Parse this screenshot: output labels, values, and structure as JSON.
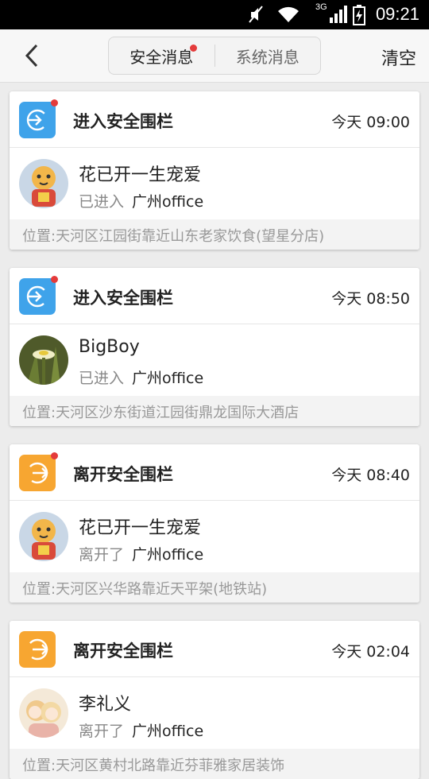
{
  "status_bar": {
    "network": "3G",
    "time": "09:21"
  },
  "header": {
    "tabs": [
      {
        "label": "安全消息",
        "active": true,
        "has_dot": true
      },
      {
        "label": "系统消息",
        "active": false,
        "has_dot": false
      }
    ],
    "clear_label": "清空"
  },
  "messages": [
    {
      "type": "enter",
      "title": "进入安全围栏",
      "time": "今天 09:00",
      "user": "花已开一生宠爱",
      "action": "已进入",
      "fence": "广州office",
      "location": "位置:天河区江园街靠近山东老家饮食(望星分店)",
      "unread": true,
      "avatar": "tiger-avatar"
    },
    {
      "type": "enter",
      "title": "进入安全围栏",
      "time": "今天 08:50",
      "user": "BigBoy",
      "action": "已进入",
      "fence": "广州office",
      "location": "位置:天河区沙东街道江园街鼎龙国际大酒店",
      "unread": true,
      "avatar": "flower-avatar"
    },
    {
      "type": "leave",
      "title": "离开安全围栏",
      "time": "今天 08:40",
      "user": "花已开一生宠爱",
      "action": "离开了",
      "fence": "广州office",
      "location": "位置:天河区兴华路靠近天平架(地铁站)",
      "unread": true,
      "avatar": "tiger-avatar"
    },
    {
      "type": "leave",
      "title": "离开安全围栏",
      "time": "今天 02:04",
      "user": "李礼义",
      "action": "离开了",
      "fence": "广州office",
      "location": "位置:天河区黄村北路靠近芬菲雅家居装饰",
      "unread": false,
      "avatar": "anime-avatar"
    }
  ],
  "colors": {
    "enter_icon": "#3fa3ea",
    "leave_icon": "#f7a631",
    "unread_dot": "#e43b3b"
  }
}
